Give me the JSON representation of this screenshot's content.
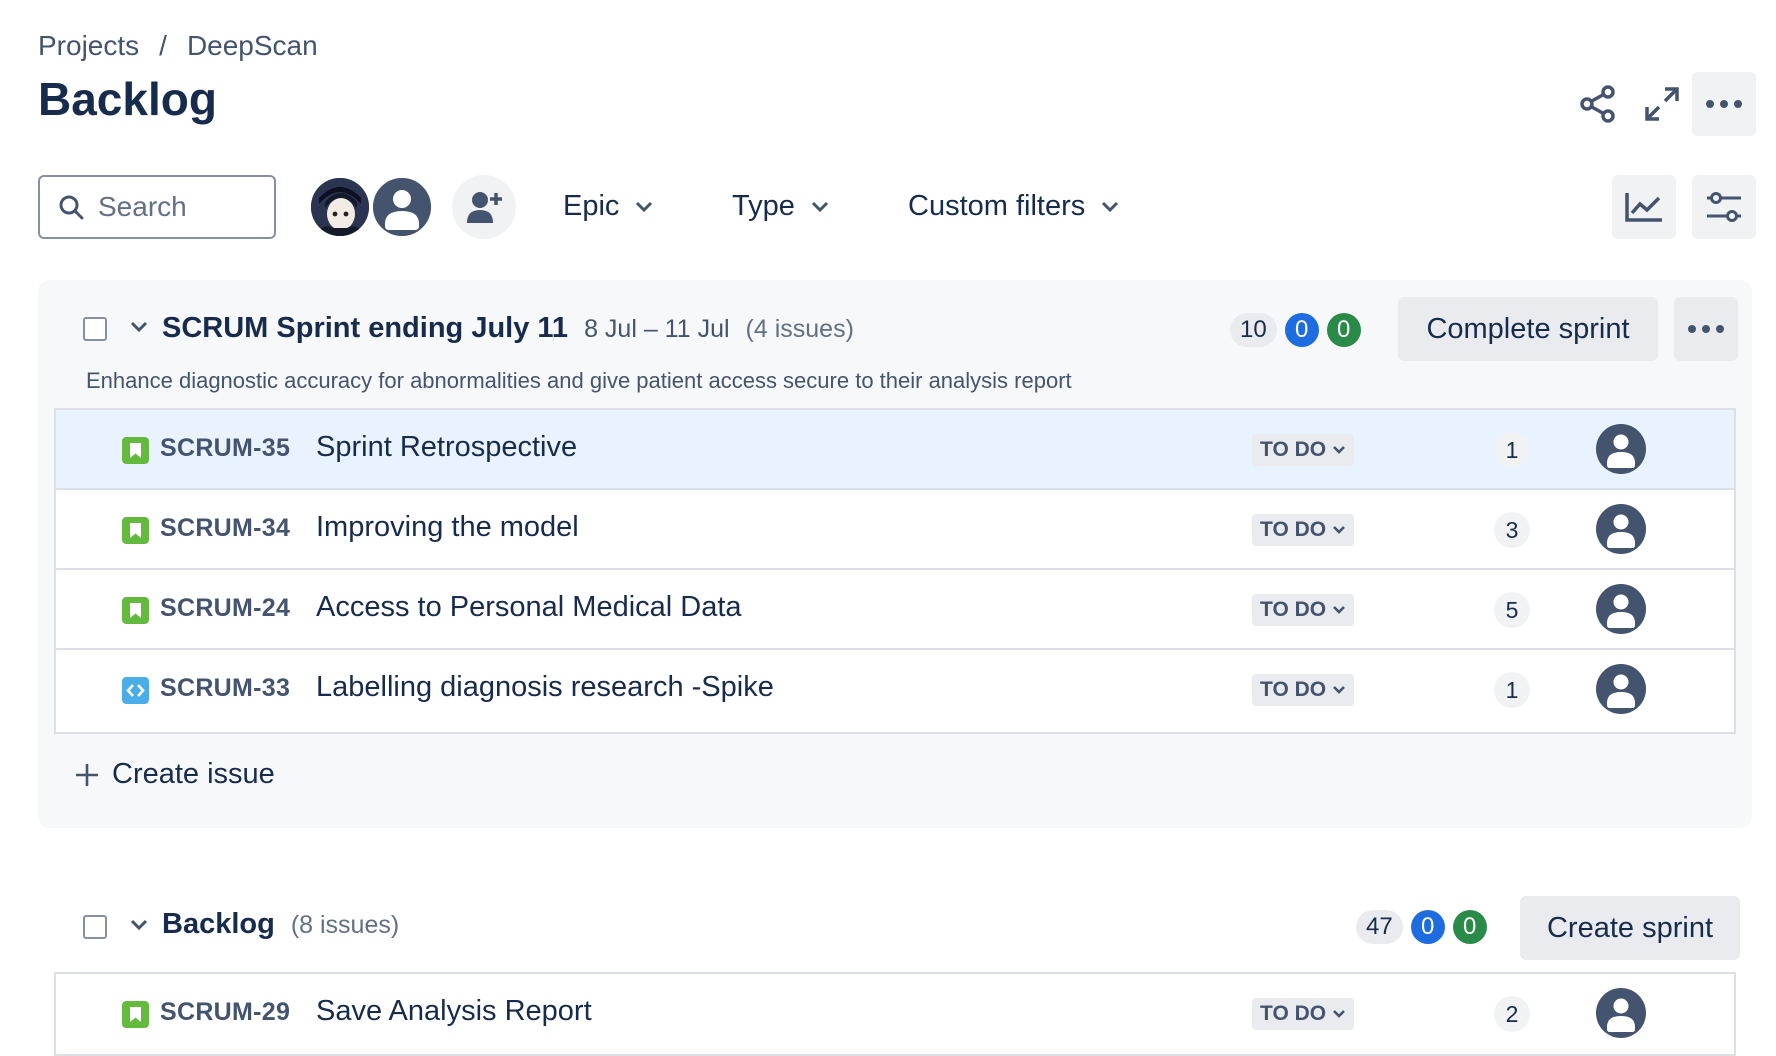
{
  "breadcrumb": {
    "projects": "Projects",
    "separator": "/",
    "project": "DeepScan"
  },
  "page": {
    "title": "Backlog"
  },
  "header_actions": {
    "share": "share-icon",
    "fullscreen": "expand-icon",
    "more": "more-icon"
  },
  "toolbar": {
    "search_placeholder": "Search",
    "filters": {
      "epic": "Epic",
      "type": "Type",
      "custom": "Custom filters"
    }
  },
  "sprint": {
    "title": "SCRUM Sprint ending July 11",
    "dates": "8 Jul – 11 Jul",
    "count": "(4 issues)",
    "points_todo": "10",
    "points_inprogress": "0",
    "points_done": "0",
    "complete_button": "Complete sprint",
    "goal": "Enhance diagnostic accuracy for abnormalities and give patient access secure to their analysis report",
    "issues": [
      {
        "type": "story",
        "key": "SCRUM-35",
        "summary": "Sprint Retrospective",
        "status": "TO DO",
        "points": "1"
      },
      {
        "type": "story",
        "key": "SCRUM-34",
        "summary": "Improving the model",
        "status": "TO DO",
        "points": "3"
      },
      {
        "type": "story",
        "key": "SCRUM-24",
        "summary": "Access to Personal Medical Data",
        "status": "TO DO",
        "points": "5"
      },
      {
        "type": "task",
        "key": "SCRUM-33",
        "summary": "Labelling diagnosis research -Spike",
        "status": "TO DO",
        "points": "1"
      }
    ],
    "create_issue": "Create issue"
  },
  "backlog": {
    "title": "Backlog",
    "count": "(8 issues)",
    "points_todo": "47",
    "points_inprogress": "0",
    "points_done": "0",
    "create_sprint_button": "Create sprint",
    "issues": [
      {
        "type": "story",
        "key": "SCRUM-29",
        "summary": "Save Analysis Report",
        "status": "TO DO",
        "points": "2"
      }
    ]
  },
  "colors": {
    "story": "#63ba3c",
    "task": "#4bade8",
    "accent_blue": "#1d6ce0",
    "accent_green": "#2a8a47"
  }
}
